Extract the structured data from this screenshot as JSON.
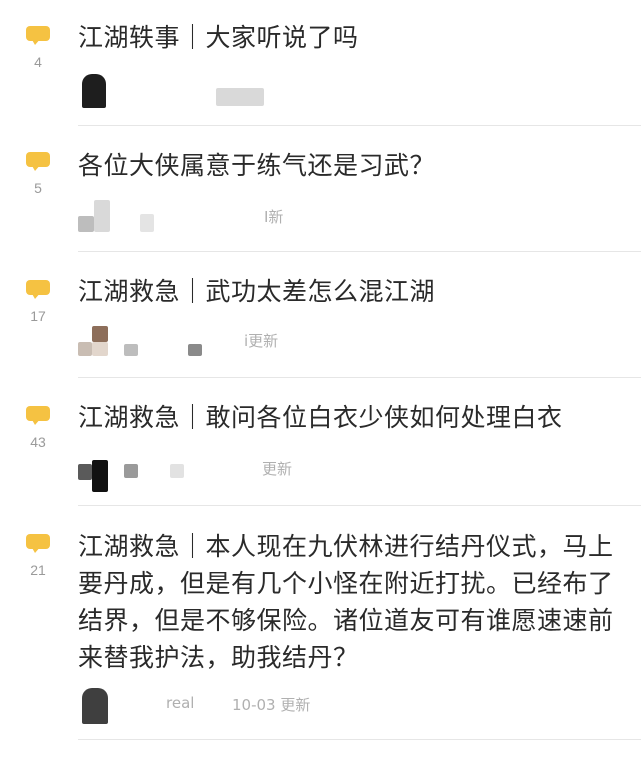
{
  "threads": [
    {
      "count": "4",
      "title": "江湖轶事｜大家听说了吗",
      "meta": ""
    },
    {
      "count": "5",
      "title": "各位大侠属意于练气还是习武？",
      "meta": "I新"
    },
    {
      "count": "17",
      "title": "江湖救急｜武功太差怎么混江湖",
      "meta": "i更新"
    },
    {
      "count": "43",
      "title": "江湖救急｜敢问各位白衣少侠如何处理白衣",
      "meta": "更新"
    },
    {
      "count": "21",
      "title": "江湖救急｜本人现在九伏林进行结丹仪式，马上要丹成，但是有几个小怪在附近打扰。已经布了结界，但是不够保险。诸位道友可有谁愿速速前来替我护法，助我结丹？",
      "meta_user": "real",
      "meta": "10-03 更新"
    }
  ],
  "colors": {
    "bubble": "#f5c242",
    "count": "#9a9a9a",
    "meta": "#b0b0b0",
    "divider": "#e6e6e6"
  },
  "icons": {
    "comment": "comment-bubble-icon"
  }
}
